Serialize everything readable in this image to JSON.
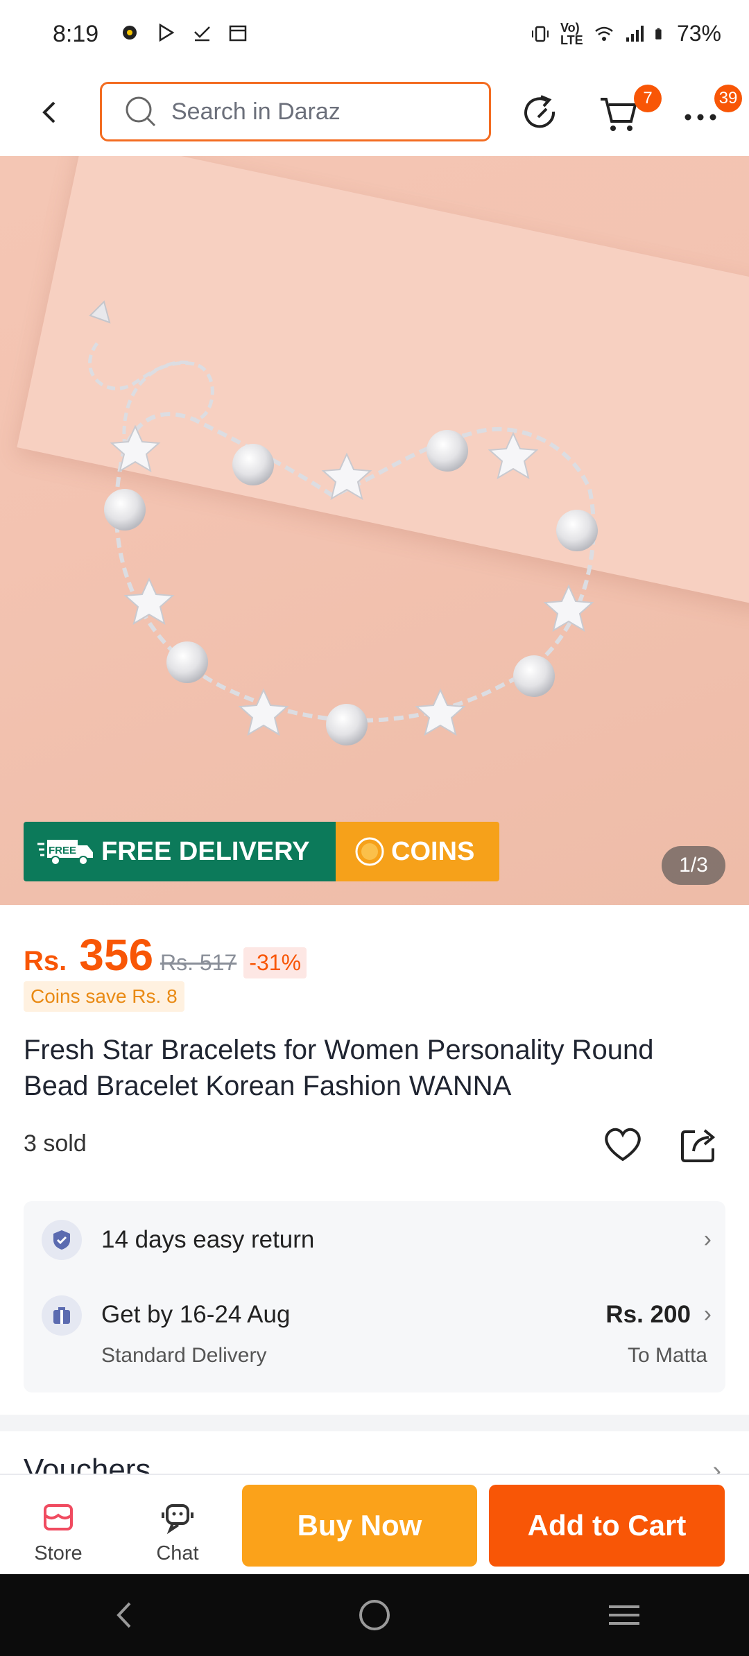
{
  "status_bar": {
    "time": "8:19",
    "battery": "73%",
    "network_label": "Vo) LTE"
  },
  "header": {
    "search_placeholder": "Search in Daraz",
    "cart_badge": "7",
    "more_badge": "39"
  },
  "product": {
    "image_counter": "1/3",
    "promo_free_delivery": "FREE DELIVERY",
    "promo_free_tag": "FREE",
    "promo_coins": "COINS",
    "currency": "Rs.",
    "price": "356",
    "old_price": "Rs. 517",
    "discount": "-31%",
    "coins_save": "Coins save Rs. 8",
    "title": "Fresh Star Bracelets for Women Personality Round Bead Bracelet Korean Fashion WANNA",
    "sold": "3 sold"
  },
  "delivery": {
    "return_text": "14 days easy return",
    "delivery_text": "Get by 16-24 Aug",
    "delivery_sub": "Standard Delivery",
    "delivery_fee": "Rs. 200",
    "delivery_location": "To Matta"
  },
  "vouchers": {
    "label": "Vouchers"
  },
  "action_bar": {
    "store_label": "Store",
    "chat_label": "Chat",
    "buy_now": "Buy Now",
    "add_to_cart": "Add to Cart"
  },
  "colors": {
    "brand_orange": "#f85606",
    "buy_now_yellow": "#fba21a",
    "free_delivery_green": "#0c7a5a"
  }
}
